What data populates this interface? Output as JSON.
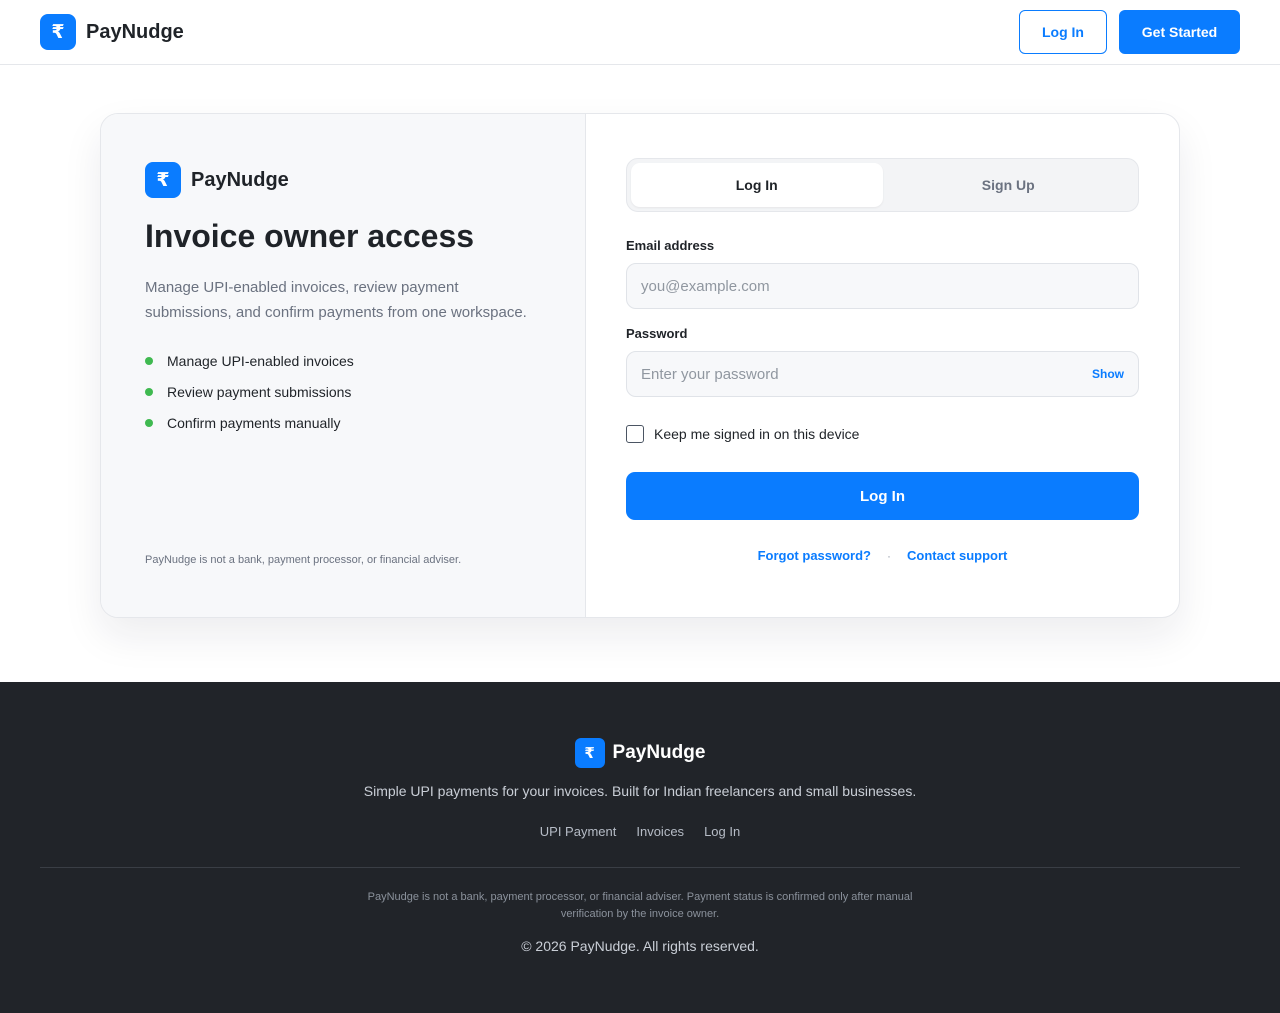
{
  "header": {
    "logo_glyph": "₹",
    "brand": "PayNudge",
    "login_label": "Log In",
    "get_started_label": "Get Started"
  },
  "left_panel": {
    "logo_glyph": "₹",
    "brand": "PayNudge",
    "title": "Invoice owner access",
    "description": "Manage UPI-enabled invoices, review payment submissions, and confirm payments from one workspace.",
    "features": [
      "Manage UPI-enabled invoices",
      "Review payment submissions",
      "Confirm payments manually"
    ],
    "disclaimer": "PayNudge is not a bank, payment processor, or financial adviser."
  },
  "auth": {
    "tabs": [
      {
        "label": "Log In",
        "active": true
      },
      {
        "label": "Sign Up",
        "active": false
      }
    ],
    "email_label": "Email address",
    "email_value": "",
    "email_placeholder": "you@example.com",
    "password_label": "Password",
    "password_value": "",
    "password_placeholder": "Enter your password",
    "show_label": "Show",
    "remember_label": "Keep me signed in on this device",
    "remember_checked": false,
    "submit_label": "Log In",
    "forgot_label": "Forgot password?",
    "separator": "·",
    "support_label": "Contact support"
  },
  "footer": {
    "logo_glyph": "₹",
    "brand": "PayNudge",
    "tagline": "Simple UPI payments for your invoices. Built for Indian freelancers and small businesses.",
    "links": [
      "UPI Payment",
      "Invoices",
      "Log In"
    ],
    "disclaimer": "PayNudge is not a bank, payment processor, or financial adviser. Payment status is confirmed only after manual verification by the invoice owner.",
    "copyright": "© 2026 PayNudge. All rights reserved."
  },
  "colors": {
    "accent": "#0a7cff",
    "success_dot": "#3fb950",
    "footer_bg": "#212429"
  },
  "icons": {
    "logo": "rupee-icon",
    "bullet": "green-dot-icon"
  }
}
